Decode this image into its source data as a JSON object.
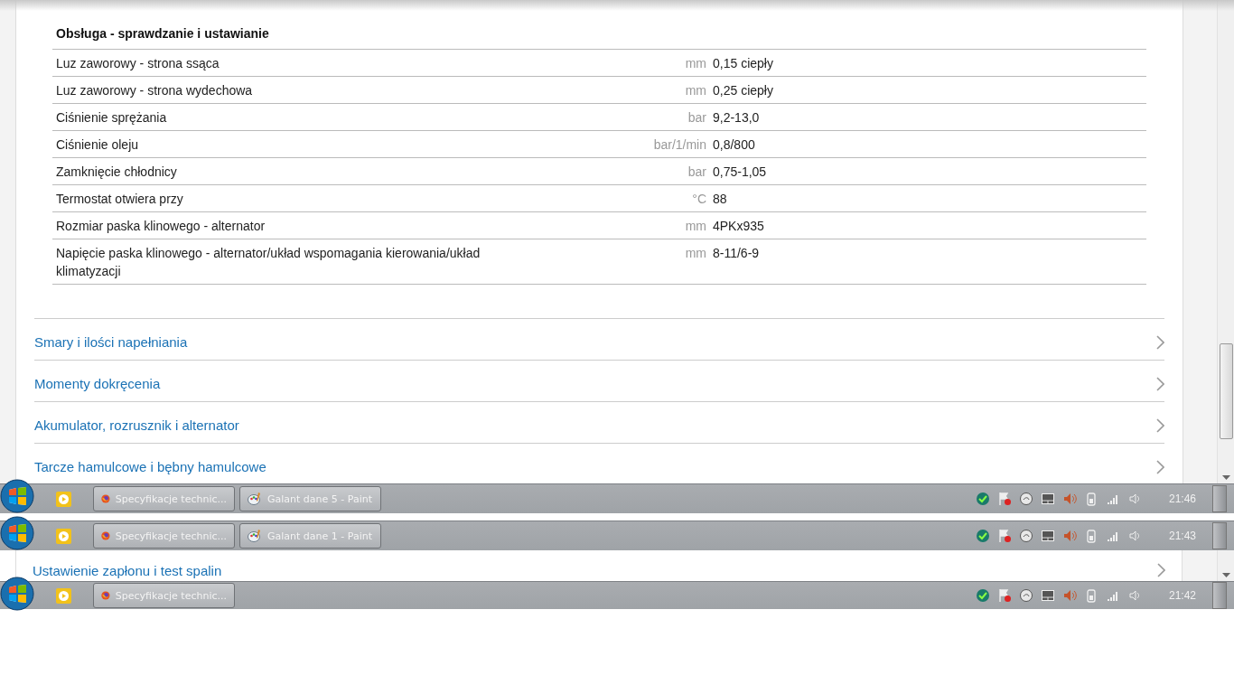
{
  "page": {
    "section_title": "Obsługa - sprawdzanie i ustawianie",
    "rows": [
      {
        "label": "Luz zaworowy - strona ssąca",
        "unit": "mm",
        "value": "0,15 ciepły"
      },
      {
        "label": "Luz zaworowy - strona wydechowa",
        "unit": "mm",
        "value": "0,25 ciepły"
      },
      {
        "label": "Ciśnienie sprężania",
        "unit": "bar",
        "value": "9,2-13,0"
      },
      {
        "label": "Ciśnienie oleju",
        "unit": "bar/1/min",
        "value": "0,8/800"
      },
      {
        "label": "Zamknięcie chłodnicy",
        "unit": "bar",
        "value": "0,75-1,05"
      },
      {
        "label": "Termostat otwiera przy",
        "unit": "°C",
        "value": "88"
      },
      {
        "label": "Rozmiar paska klinowego - alternator",
        "unit": "mm",
        "value": "4PKx935"
      },
      {
        "label": "Napięcie paska klinowego - alternator/układ wspomagania kierowania/układ klimatyzacji",
        "unit": "mm",
        "value": "8-11/6-9"
      }
    ],
    "links": [
      "Smary i ilości napełniania",
      "Momenty dokręcenia",
      "Akumulator, rozrusznik i alternator",
      "Tarcze hamulcowe i bębny hamulcowe"
    ]
  },
  "taskbars": [
    {
      "tasks": [
        {
          "kind": "browser",
          "label": "Specyfikacje technic..."
        },
        {
          "kind": "paint",
          "label": "Galant dane 5 - Paint"
        }
      ],
      "clock": "21:46"
    },
    {
      "tasks": [
        {
          "kind": "browser",
          "label": "Specyfikacje technic..."
        },
        {
          "kind": "paint",
          "label": "Galant dane 1 - Paint"
        }
      ],
      "clock": "21:43"
    },
    {
      "tasks": [
        {
          "kind": "browser",
          "label": "Specyfikacje technic..."
        }
      ],
      "clock": "21:42"
    }
  ],
  "page_fragment": {
    "link": "Ustawienie zapłonu i test spalin"
  }
}
